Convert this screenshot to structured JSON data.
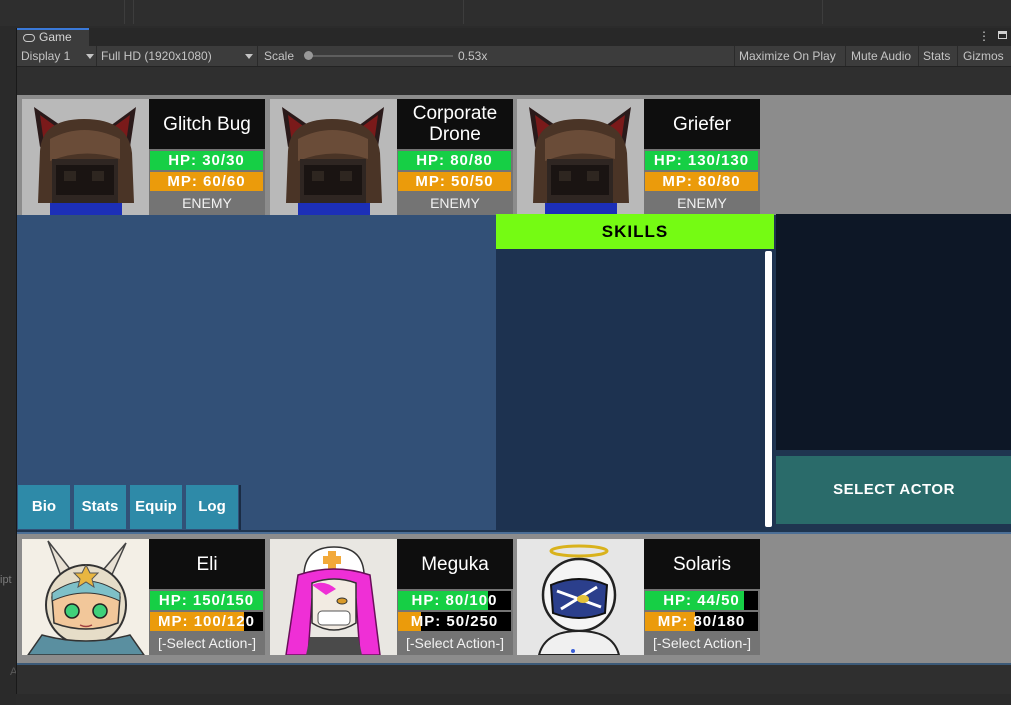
{
  "editor": {
    "tab_title": "Game",
    "kebab": "⋮",
    "toolbar": {
      "display": "Display 1",
      "resolution": "Full HD (1920x1080)",
      "scale_label": "Scale",
      "scale_value": "0.53x",
      "scale_level": 0.0,
      "maximize_on_play": "Maximize On Play",
      "mute_audio": "Mute Audio",
      "stats": "Stats",
      "gizmos": "Gizmos"
    },
    "left_fragment": "ipt",
    "left_fragment2": "A"
  },
  "enemies": [
    {
      "name": "Glitch Bug",
      "hp_text": "HP: 30/30",
      "hp": 30,
      "hp_max": 30,
      "mp_text": "MP: 60/60",
      "mp": 60,
      "mp_max": 60,
      "role": "ENEMY"
    },
    {
      "name": "Corporate Drone",
      "hp_text": "HP: 80/80",
      "hp": 80,
      "hp_max": 80,
      "mp_text": "MP: 50/50",
      "mp": 50,
      "mp_max": 50,
      "role": "ENEMY"
    },
    {
      "name": "Griefer",
      "hp_text": "HP: 130/130",
      "hp": 130,
      "hp_max": 130,
      "mp_text": "MP: 80/80",
      "mp": 80,
      "mp_max": 80,
      "role": "ENEMY"
    }
  ],
  "party": [
    {
      "name": "Eli",
      "hp_text": "HP: 150/150",
      "hp": 150,
      "hp_max": 150,
      "mp_text": "MP: 100/120",
      "mp": 100,
      "mp_max": 120,
      "action": "[-Select Action-]"
    },
    {
      "name": "Meguka",
      "hp_text": "HP: 80/100",
      "hp": 80,
      "hp_max": 100,
      "mp_text": "MP: 50/250",
      "mp": 50,
      "mp_max": 250,
      "action": "[-Select Action-]"
    },
    {
      "name": "Solaris",
      "hp_text": "HP: 44/50",
      "hp": 44,
      "hp_max": 50,
      "mp_text": "MP: 80/180",
      "mp": 80,
      "mp_max": 180,
      "action": "[-Select Action-]"
    }
  ],
  "panels": {
    "skills_header": "SKILLS",
    "select_actor": "SELECT ACTOR",
    "tabs": [
      "Bio",
      "Stats",
      "Equip",
      "Log"
    ]
  },
  "colors": {
    "hp": "#16cf45",
    "mp": "#eb9b0b",
    "skills_header": "#75fb13",
    "tab_button": "#2e8aa8",
    "select_actor": "#2a6b6a"
  },
  "icons": {
    "enemy_portrait": "cat-eared-creature-icon",
    "eli_portrait": "bunny-helmet-girl-icon",
    "meguka_portrait": "nurse-girl-icon",
    "solaris_portrait": "haloed-astronaut-icon"
  }
}
